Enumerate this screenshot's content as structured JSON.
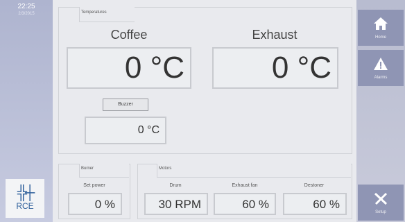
{
  "clock": {
    "time": "22:25",
    "date": "2/3/2015"
  },
  "logo": {
    "mark": "╬┼",
    "text": "RCE"
  },
  "temperatures": {
    "group_label": "Temperatures",
    "coffee": {
      "label": "Coffee",
      "value": "0 °C"
    },
    "exhaust": {
      "label": "Exhaust",
      "value": "0 °C"
    },
    "buzzer": {
      "label": "Buzzer",
      "value": "0 °C"
    }
  },
  "burner": {
    "group_label": "Burner",
    "set_power_label": "Set power",
    "set_power_value": "0 %"
  },
  "motors": {
    "group_label": "Motors",
    "drum": {
      "label": "Drum",
      "value": "30 RPM"
    },
    "exhaust_fan": {
      "label": "Exhaust fan",
      "value": "60 %"
    },
    "destoner": {
      "label": "Destoner",
      "value": "60 %"
    }
  },
  "nav": {
    "home": {
      "label": "Home",
      "icon": "home-icon"
    },
    "alarms": {
      "label": "Alarms",
      "icon": "warning-icon"
    },
    "setup": {
      "label": "Setup",
      "icon": "tools-icon"
    }
  },
  "colors": {
    "nav_button": "#8f95b4",
    "panel": "#e9eaee",
    "logo_blue": "#2e5f9b"
  }
}
